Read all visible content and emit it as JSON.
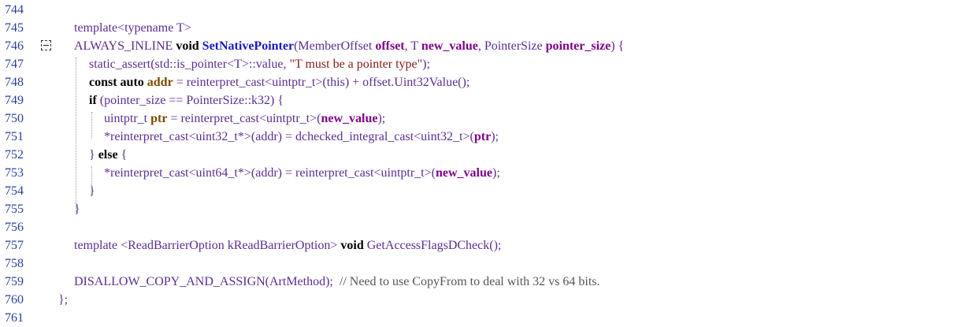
{
  "editor": {
    "lines": [
      {
        "num": "744",
        "segments": []
      },
      {
        "num": "745",
        "segments": [
          {
            "t": "template<typename T>",
            "c": "ty"
          }
        ]
      },
      {
        "num": "746",
        "fold": true,
        "segments": [
          {
            "t": "ALWAYS_INLINE ",
            "c": "mac"
          },
          {
            "t": "void ",
            "c": "kw"
          },
          {
            "t": "SetNativePointer",
            "c": "fn"
          },
          {
            "t": "(MemberOffset ",
            "c": "ty"
          },
          {
            "t": "offset",
            "c": "pm"
          },
          {
            "t": ", T ",
            "c": "ty"
          },
          {
            "t": "new_value",
            "c": "pm"
          },
          {
            "t": ", PointerSize ",
            "c": "ty"
          },
          {
            "t": "pointer_size",
            "c": "pm"
          },
          {
            "t": ") {",
            "c": "ty"
          }
        ]
      },
      {
        "num": "747",
        "segments": [
          {
            "t": "static_assert(std::is_pointer<T>::value, ",
            "c": "ty"
          },
          {
            "t": "\"T must be a pointer type\"",
            "c": "str"
          },
          {
            "t": ");",
            "c": "ty"
          }
        ]
      },
      {
        "num": "748",
        "segments": [
          {
            "t": "const auto ",
            "c": "kw"
          },
          {
            "t": "addr",
            "c": "lv"
          },
          {
            "t": " = reinterpret_cast<uintptr_t>(this) + offset.Uint32Value();",
            "c": "ty"
          }
        ]
      },
      {
        "num": "749",
        "segments": [
          {
            "t": "if ",
            "c": "kw"
          },
          {
            "t": "(pointer_size == PointerSize::k32) {",
            "c": "ty"
          }
        ]
      },
      {
        "num": "750",
        "segments": [
          {
            "t": "uintptr_t ",
            "c": "ty"
          },
          {
            "t": "ptr",
            "c": "lv"
          },
          {
            "t": " = reinterpret_cast<uintptr_t>(",
            "c": "ty"
          },
          {
            "t": "new_value",
            "c": "pm"
          },
          {
            "t": ");",
            "c": "ty"
          }
        ]
      },
      {
        "num": "751",
        "segments": [
          {
            "t": "*reinterpret_cast<uint32_t*>(addr) = dchecked_integral_cast<uint32_t>(",
            "c": "ty"
          },
          {
            "t": "ptr",
            "c": "pm"
          },
          {
            "t": ");",
            "c": "ty"
          }
        ]
      },
      {
        "num": "752",
        "segments": [
          {
            "t": "} ",
            "c": "ty"
          },
          {
            "t": "else",
            "c": "kw"
          },
          {
            "t": " {",
            "c": "ty"
          }
        ]
      },
      {
        "num": "753",
        "segments": [
          {
            "t": "*reinterpret_cast<uint64_t*>(addr) = reinterpret_cast<uintptr_t>(",
            "c": "ty"
          },
          {
            "t": "new_value",
            "c": "pm"
          },
          {
            "t": ");",
            "c": "ty"
          }
        ]
      },
      {
        "num": "754",
        "segments": [
          {
            "t": "}",
            "c": "ty"
          }
        ]
      },
      {
        "num": "755",
        "segments": [
          {
            "t": "}",
            "c": "ty"
          }
        ]
      },
      {
        "num": "756",
        "segments": []
      },
      {
        "num": "757",
        "segments": [
          {
            "t": "template <ReadBarrierOption kReadBarrierOption> ",
            "c": "ty"
          },
          {
            "t": "void ",
            "c": "kw"
          },
          {
            "t": "GetAccessFlagsDCheck();",
            "c": "ty"
          }
        ]
      },
      {
        "num": "758",
        "segments": []
      },
      {
        "num": "759",
        "segments": [
          {
            "t": "DISALLOW_COPY_AND_ASSIGN(ArtMethod);  ",
            "c": "ty"
          },
          {
            "t": "// Need to use CopyFrom to deal with 32 vs 64 bits.",
            "c": "cmt"
          }
        ]
      },
      {
        "num": "760",
        "segments": [
          {
            "t": "};",
            "c": "ty"
          }
        ]
      },
      {
        "num": "761",
        "segments": []
      }
    ]
  }
}
